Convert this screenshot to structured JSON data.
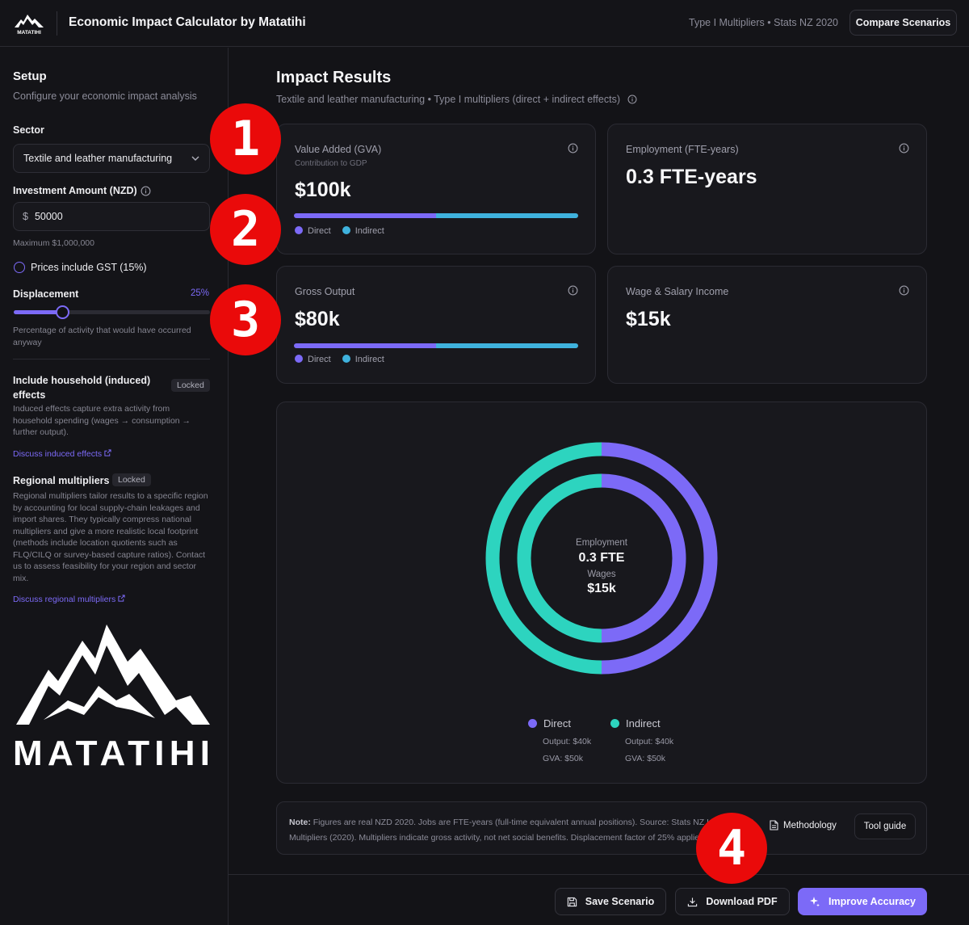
{
  "header": {
    "title": "Economic Impact Calculator by Matatihi",
    "meta": "Type I Multipliers • Stats NZ 2020",
    "compare_label": "Compare Scenarios"
  },
  "sidebar": {
    "title": "Setup",
    "subtitle": "Configure your economic impact analysis",
    "sector_label": "Sector",
    "sector_value": "Textile and leather manufacturing",
    "investment_label": "Investment Amount (NZD)",
    "currency_symbol": "$",
    "investment_value": "50000",
    "investment_hint": "Maximum $1,000,000",
    "gst_label": "Prices include GST (15%)",
    "displacement_label": "Displacement",
    "displacement_value": "25%",
    "displacement_fraction": 0.25,
    "displacement_hint": "Percentage of activity that would have occurred anyway",
    "household_label": "Include household (induced) effects",
    "household_badge": "Locked",
    "household_desc": "Induced effects capture extra activity from household spending (wages → consumption → further output).",
    "household_link": "Discuss induced effects",
    "regional_label": "Regional multipliers",
    "regional_badge": "Locked",
    "regional_desc": "Regional multipliers tailor results to a specific region by accounting for local supply-chain leakages and import shares. They typically compress national multipliers and give a more realistic local footprint (methods include location quotients such as FLQ/CILQ or survey-based capture ratios). Contact us to assess feasibility for your region and sector mix.",
    "regional_link": "Discuss regional multipliers",
    "logo_text": "MATATIHI"
  },
  "main": {
    "title": "Impact Results",
    "subtitle": "Textile and leather manufacturing • Type I multipliers (direct + indirect effects)",
    "cards": {
      "gva": {
        "label": "Value Added (GVA)",
        "note": "Contribution to GDP",
        "value": "$100k",
        "direct_fraction": 0.5
      },
      "employment": {
        "label": "Employment (FTE-years)",
        "value": "0.3 FTE-years"
      },
      "output": {
        "label": "Gross Output",
        "value": "$80k",
        "direct_fraction": 0.5
      },
      "wages": {
        "label": "Wage & Salary Income",
        "value": "$15k"
      }
    },
    "legend_direct": "Direct",
    "legend_indirect": "Indirect",
    "donut": {
      "center_label_1": "Employment",
      "center_value_1": "0.3 FTE",
      "center_label_2": "Wages",
      "center_value_2": "$15k",
      "direct_output": "Output: $40k",
      "direct_gva": "GVA: $50k",
      "indirect_output": "Output: $40k",
      "indirect_gva": "GVA: $50k",
      "outer_direct_fraction": 0.5,
      "inner_direct_fraction": 0.5
    },
    "note": {
      "bold": "Note:",
      "text": " Figures are real NZD 2020. Jobs are FTE-years (full-time equivalent annual positions). Source: Stats NZ Input-Output Multipliers (2020). Multipliers indicate gross activity, not net social benefits. Displacement factor of 25% applied.",
      "methodology": "Methodology",
      "guide": "Tool guide"
    }
  },
  "footer": {
    "save": "Save Scenario",
    "download": "Download PDF",
    "improve": "Improve Accuracy"
  },
  "badges": [
    "1",
    "2",
    "3",
    "4"
  ],
  "colors": {
    "accent": "#7c6af7",
    "indirect_bar": "#3fb2dd",
    "indirect_ring": "#2dd4bf",
    "badge": "#ea0a0a"
  }
}
